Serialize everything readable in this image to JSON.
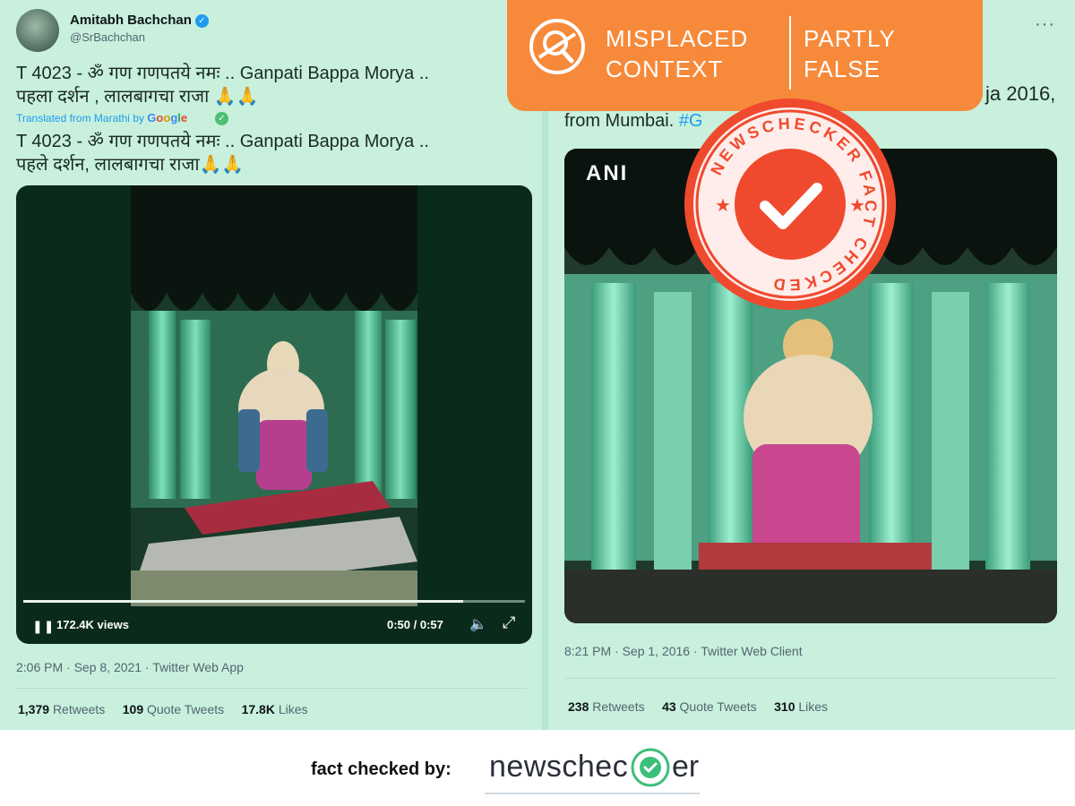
{
  "left_tweet": {
    "name": "Amitabh Bachchan",
    "handle": "@SrBachchan",
    "text_line_1": "T 4023 - ॐ गण गणपतये नमः .. Ganpati Bappa Morya ..",
    "text_line_2": "पहला दर्शन , लालबागचा राजा 🙏🙏",
    "translated_prefix": "Translated from Marathi by",
    "translated_brand": "Google",
    "translation_line_1": "T 4023 - ॐ गण गणपतये नमः .. Ganpati Bappa Morya ..",
    "translation_line_2": "पहले दर्शन, लालबागचा राजा🙏🙏",
    "views": "172.4K views",
    "video_time": "0:50 / 0:57",
    "video_progress": 0.877,
    "timestamp": "2:06 PM · Sep 8, 2021 · Twitter Web App",
    "retweets_count": "1,379",
    "retweets_label": "Retweets",
    "quotes_count": "109",
    "quotes_label": "Quote Tweets",
    "likes_count": "17.8K",
    "likes_label": "Likes"
  },
  "right_tweet": {
    "text_partial_top": "ja 2016,",
    "text_line": "from Mumbai. ",
    "hashtag_partial": "#G",
    "media_watermark": "ANI",
    "timestamp": "8:21 PM · Sep 1, 2016 · Twitter Web Client",
    "retweets_count": "238",
    "retweets_label": "Retweets",
    "quotes_count": "43",
    "quotes_label": "Quote Tweets",
    "likes_count": "310",
    "likes_label": "Likes"
  },
  "banner": {
    "label_a_line_1": "MISPLACED",
    "label_a_line_2": "CONTEXT",
    "label_b_line_1": "PARTLY",
    "label_b_line_2": "FALSE"
  },
  "stamp": {
    "text": "NEWSCHECKER FACT CHECKED"
  },
  "footer": {
    "label": "fact checked by:",
    "brand_part_1": "newschec",
    "brand_part_2": "er"
  },
  "colors": {
    "tweet_background": "#c8f0dc",
    "banner_orange": "#f68a3a",
    "stamp_red": "#e8452c",
    "twitter_blue": "#1d9bf0",
    "brand_green": "#3cbf7a"
  }
}
